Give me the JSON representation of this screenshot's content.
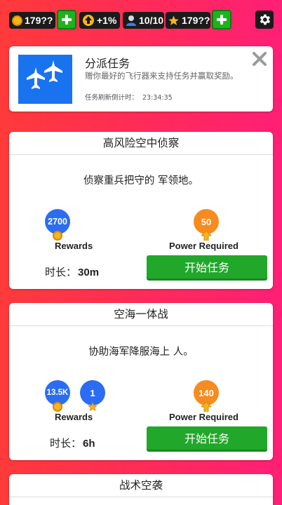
{
  "topbar": {
    "coins": "179??",
    "power_bonus": "+1%",
    "pilots": "10/10",
    "stars": "179??"
  },
  "banner": {
    "title": "分派任务",
    "description": "赠你最好的飞行器来支持任务并赢取奖励。",
    "timer_label": "任务刷新倒计时：",
    "timer_value": "23:34:35"
  },
  "missions": [
    {
      "title": "高风险空中侦察",
      "description": "侦察重兵把守的 军领地。",
      "rewards": [
        "2700"
      ],
      "rewards_label": "Rewards",
      "power": "50",
      "power_label": "Power Required",
      "duration_label": "时长：",
      "duration_value": "30m",
      "start_label": "开始任务"
    },
    {
      "title": "空海一体战",
      "description": "协助海军降服海上 人。",
      "rewards": [
        "13.5K",
        "1"
      ],
      "rewards_label": "Rewards",
      "power": "140",
      "power_label": "Power Required",
      "duration_label": "时长：",
      "duration_value": "6h",
      "start_label": "开始任务"
    },
    {
      "title": "战术空袭"
    }
  ]
}
